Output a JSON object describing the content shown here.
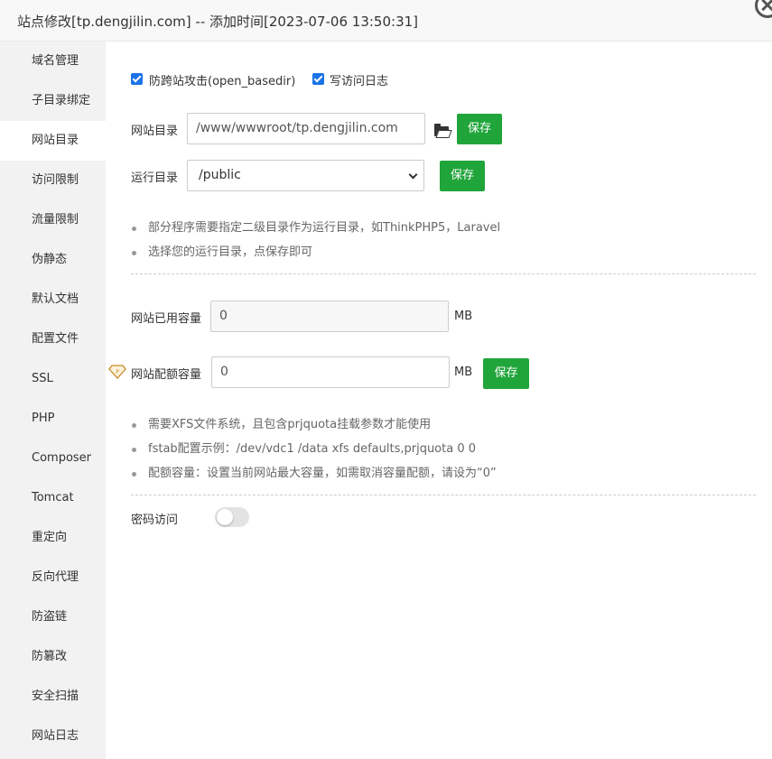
{
  "dialog": {
    "title": "站点修改[tp.dengjilin.com] -- 添加时间[2023-07-06 13:50:31]"
  },
  "sidebar": {
    "items": [
      {
        "label": "域名管理",
        "active": false
      },
      {
        "label": "子目录绑定",
        "active": false
      },
      {
        "label": "网站目录",
        "active": true
      },
      {
        "label": "访问限制",
        "active": false
      },
      {
        "label": "流量限制",
        "active": false
      },
      {
        "label": "伪静态",
        "active": false
      },
      {
        "label": "默认文档",
        "active": false
      },
      {
        "label": "配置文件",
        "active": false
      },
      {
        "label": "SSL",
        "active": false
      },
      {
        "label": "PHP",
        "active": false
      },
      {
        "label": "Composer",
        "active": false
      },
      {
        "label": "Tomcat",
        "active": false
      },
      {
        "label": "重定向",
        "active": false
      },
      {
        "label": "反向代理",
        "active": false
      },
      {
        "label": "防盗链",
        "active": false
      },
      {
        "label": "防篡改",
        "active": false
      },
      {
        "label": "安全扫描",
        "active": false
      },
      {
        "label": "网站日志",
        "active": false
      }
    ]
  },
  "options": {
    "open_basedir_label": "防跨站攻击(open_basedir)",
    "open_basedir_checked": true,
    "access_log_label": "写访问日志",
    "access_log_checked": true
  },
  "site_dir": {
    "label": "网站目录",
    "value": "/www/wwwroot/tp.dengjilin.com",
    "folder_icon": "folder-open-icon",
    "save_label": "保存"
  },
  "run_dir": {
    "label": "运行目录",
    "selected": "/public",
    "save_label": "保存"
  },
  "run_dir_tips": [
    "部分程序需要指定二级目录作为运行目录，如ThinkPHP5，Laravel",
    "选择您的运行目录，点保存即可"
  ],
  "quota": {
    "used_label": "网站已用容量",
    "used_value": "0",
    "used_unit": "MB",
    "limit_label": "网站配额容量",
    "limit_value": "0",
    "limit_unit": "MB",
    "limit_icon": "pro-diamond-icon",
    "save_label": "保存"
  },
  "quota_tips": [
    "需要XFS文件系统，且包含prjquota挂载参数才能使用",
    "fstab配置示例：/dev/vdc1 /data xfs defaults,prjquota 0 0",
    "配额容量：设置当前网站最大容量，如需取消容量配额，请设为“0”"
  ],
  "password_access": {
    "label": "密码访问",
    "enabled": false
  },
  "colors": {
    "accent_green": "#20a53a",
    "checkbox_blue": "#1a73e8",
    "sidebar_bg": "#f2f2f2"
  }
}
